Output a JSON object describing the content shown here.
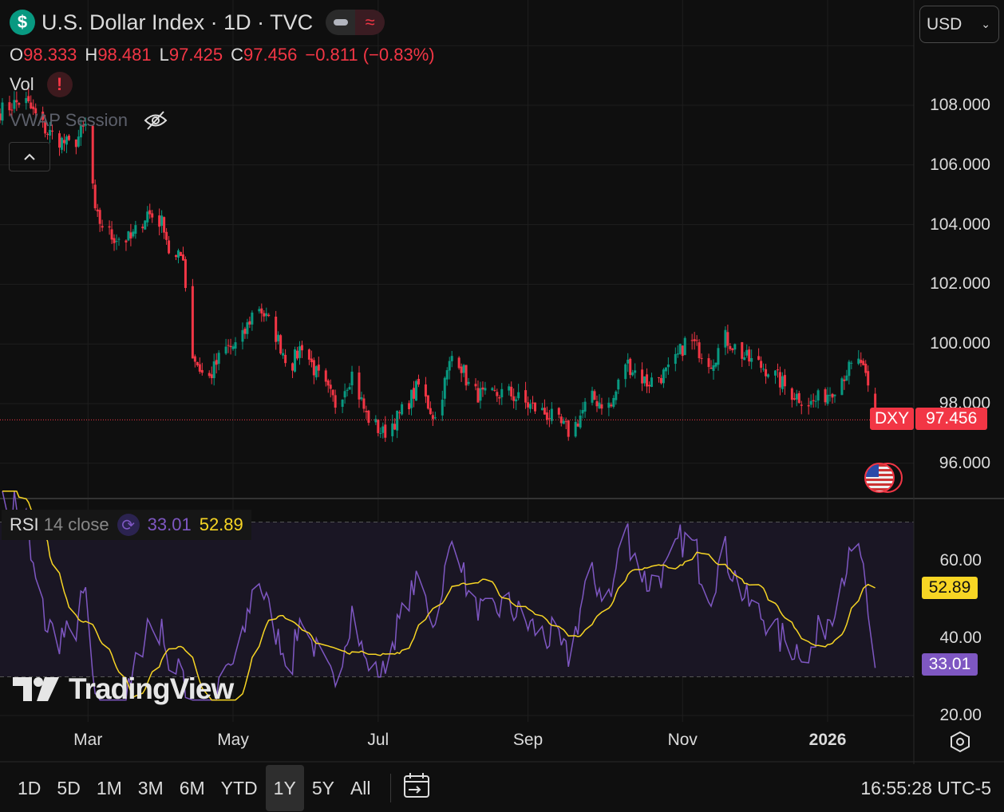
{
  "header": {
    "title": "U.S. Dollar Index · 1D · TVC",
    "logo": "$",
    "currency": "USD"
  },
  "ohlc": {
    "o_label": "O",
    "o": "98.333",
    "h_label": "H",
    "h": "98.481",
    "l_label": "L",
    "l": "97.425",
    "c_label": "C",
    "c": "97.456",
    "change": "−0.811 (−0.83%)"
  },
  "indicators": {
    "vol": "Vol",
    "vwap": "VWAP Session"
  },
  "rsi": {
    "label": "RSI",
    "params": "14 close",
    "rsi_value": "33.01",
    "ma_value": "52.89"
  },
  "price_tag": {
    "symbol": "DXY",
    "value": "97.456"
  },
  "colors": {
    "up": "#089981",
    "down": "#f23645",
    "rsi": "#7e57c2",
    "rsi_ma": "#f7d524",
    "bg": "#0f0f0f"
  },
  "time_axis": {
    "labels": [
      {
        "t": "Mar",
        "day": 37
      },
      {
        "t": "May",
        "day": 98
      },
      {
        "t": "Jul",
        "day": 159
      },
      {
        "t": "Sep",
        "day": 222
      },
      {
        "t": "Nov",
        "day": 287
      },
      {
        "t": "2026",
        "day": 348
      }
    ]
  },
  "toolbar": {
    "ranges": [
      "1D",
      "5D",
      "1M",
      "3M",
      "6M",
      "YTD",
      "1Y",
      "5Y",
      "All"
    ],
    "active": "1Y",
    "clock": "16:55:28 UTC-5"
  },
  "watermark": "TradingView",
  "chart_data": {
    "type": "candlestick",
    "start_date": "2025-01-23",
    "price_axis": {
      "ticks": [
        "96.000",
        "98.000",
        "100.000",
        "102.000",
        "104.000",
        "106.000",
        "108.000"
      ],
      "range": [
        95.2,
        110.5
      ]
    },
    "rsi_axis": {
      "ticks": [
        "20.00",
        "40.00",
        "60.00"
      ],
      "bands": [
        30,
        70
      ]
    },
    "close_keypoints_by_day": [
      [
        0,
        107.8
      ],
      [
        10,
        108.2
      ],
      [
        20,
        107.1
      ],
      [
        30,
        106.6
      ],
      [
        37,
        107.4
      ],
      [
        40,
        104.3
      ],
      [
        47,
        103.6
      ],
      [
        55,
        103.5
      ],
      [
        62,
        104.4
      ],
      [
        69,
        104.0
      ],
      [
        72,
        102.7
      ],
      [
        77,
        103.0
      ],
      [
        80,
        99.8
      ],
      [
        87,
        98.7
      ],
      [
        94,
        99.8
      ],
      [
        101,
        100.0
      ],
      [
        108,
        101.4
      ],
      [
        116,
        100.3
      ],
      [
        122,
        99.2
      ],
      [
        127,
        100.0
      ],
      [
        133,
        99.0
      ],
      [
        141,
        98.0
      ],
      [
        148,
        99.0
      ],
      [
        154,
        97.6
      ],
      [
        161,
        97.0
      ],
      [
        168,
        97.6
      ],
      [
        176,
        98.6
      ],
      [
        183,
        97.5
      ],
      [
        191,
        99.9
      ],
      [
        198,
        98.4
      ],
      [
        205,
        98.2
      ],
      [
        213,
        98.4
      ],
      [
        221,
        98.0
      ],
      [
        231,
        97.6
      ],
      [
        240,
        97.0
      ],
      [
        248,
        98.2
      ],
      [
        257,
        97.9
      ],
      [
        263,
        99.4
      ],
      [
        272,
        98.7
      ],
      [
        282,
        99.1
      ],
      [
        289,
        100.2
      ],
      [
        299,
        99.4
      ],
      [
        305,
        100.2
      ],
      [
        314,
        99.5
      ],
      [
        324,
        99.1
      ],
      [
        332,
        98.4
      ],
      [
        341,
        98.0
      ],
      [
        349,
        98.4
      ],
      [
        356,
        99.1
      ],
      [
        362,
        99.4
      ],
      [
        368,
        97.456
      ]
    ]
  }
}
